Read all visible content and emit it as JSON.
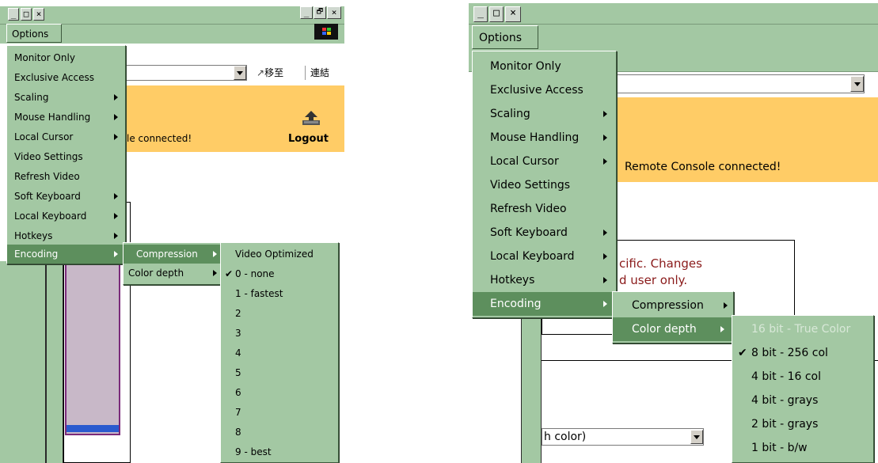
{
  "left": {
    "title_buttons": [
      "_",
      "□",
      "×"
    ],
    "browser_buttons": [
      "_",
      "🗗",
      "×"
    ],
    "options_label": "Options",
    "goto_label": "移至",
    "links_label": "連結",
    "status_text": "le connected!",
    "logout_label": "Logout",
    "main_menu": [
      "Monitor Only",
      "Exclusive Access",
      "Scaling",
      "Mouse Handling",
      "Local Cursor",
      "Video Settings",
      "Refresh Video",
      "Soft Keyboard",
      "Local Keyboard",
      "Hotkeys",
      "Encoding"
    ],
    "encoding_menu": [
      "Compression",
      "Color depth"
    ],
    "compression_menu": [
      "Video Optimized",
      "0 - none",
      "1 - fastest",
      "2",
      "3",
      "4",
      "5",
      "6",
      "7",
      "8",
      "9 - best"
    ],
    "checked_item": "0 - none"
  },
  "right": {
    "title_buttons": [
      "_",
      "□",
      "×"
    ],
    "options_label": "Options",
    "status_text": "Remote Console connected!",
    "info_line1": "cific. Changes",
    "info_line2": "d user only.",
    "select_value": "h color)",
    "main_menu": [
      "Monitor Only",
      "Exclusive Access",
      "Scaling",
      "Mouse Handling",
      "Local Cursor",
      "Video Settings",
      "Refresh Video",
      "Soft Keyboard",
      "Local Keyboard",
      "Hotkeys",
      "Encoding"
    ],
    "encoding_menu": [
      "Compression",
      "Color depth"
    ],
    "color_depth_menu": [
      "16 bit - True Color",
      "8 bit - 256 col",
      "4 bit - 16 col",
      "4 bit - grays",
      "2 bit - grays",
      "1 bit - b/w"
    ],
    "checked_item": "8 bit - 256 col"
  },
  "colors": {
    "menu_green": "#a3c8a3",
    "highlight": "#5d8f5d",
    "banner": "#ffcc66",
    "disabled_text": "#d8e8d8"
  }
}
